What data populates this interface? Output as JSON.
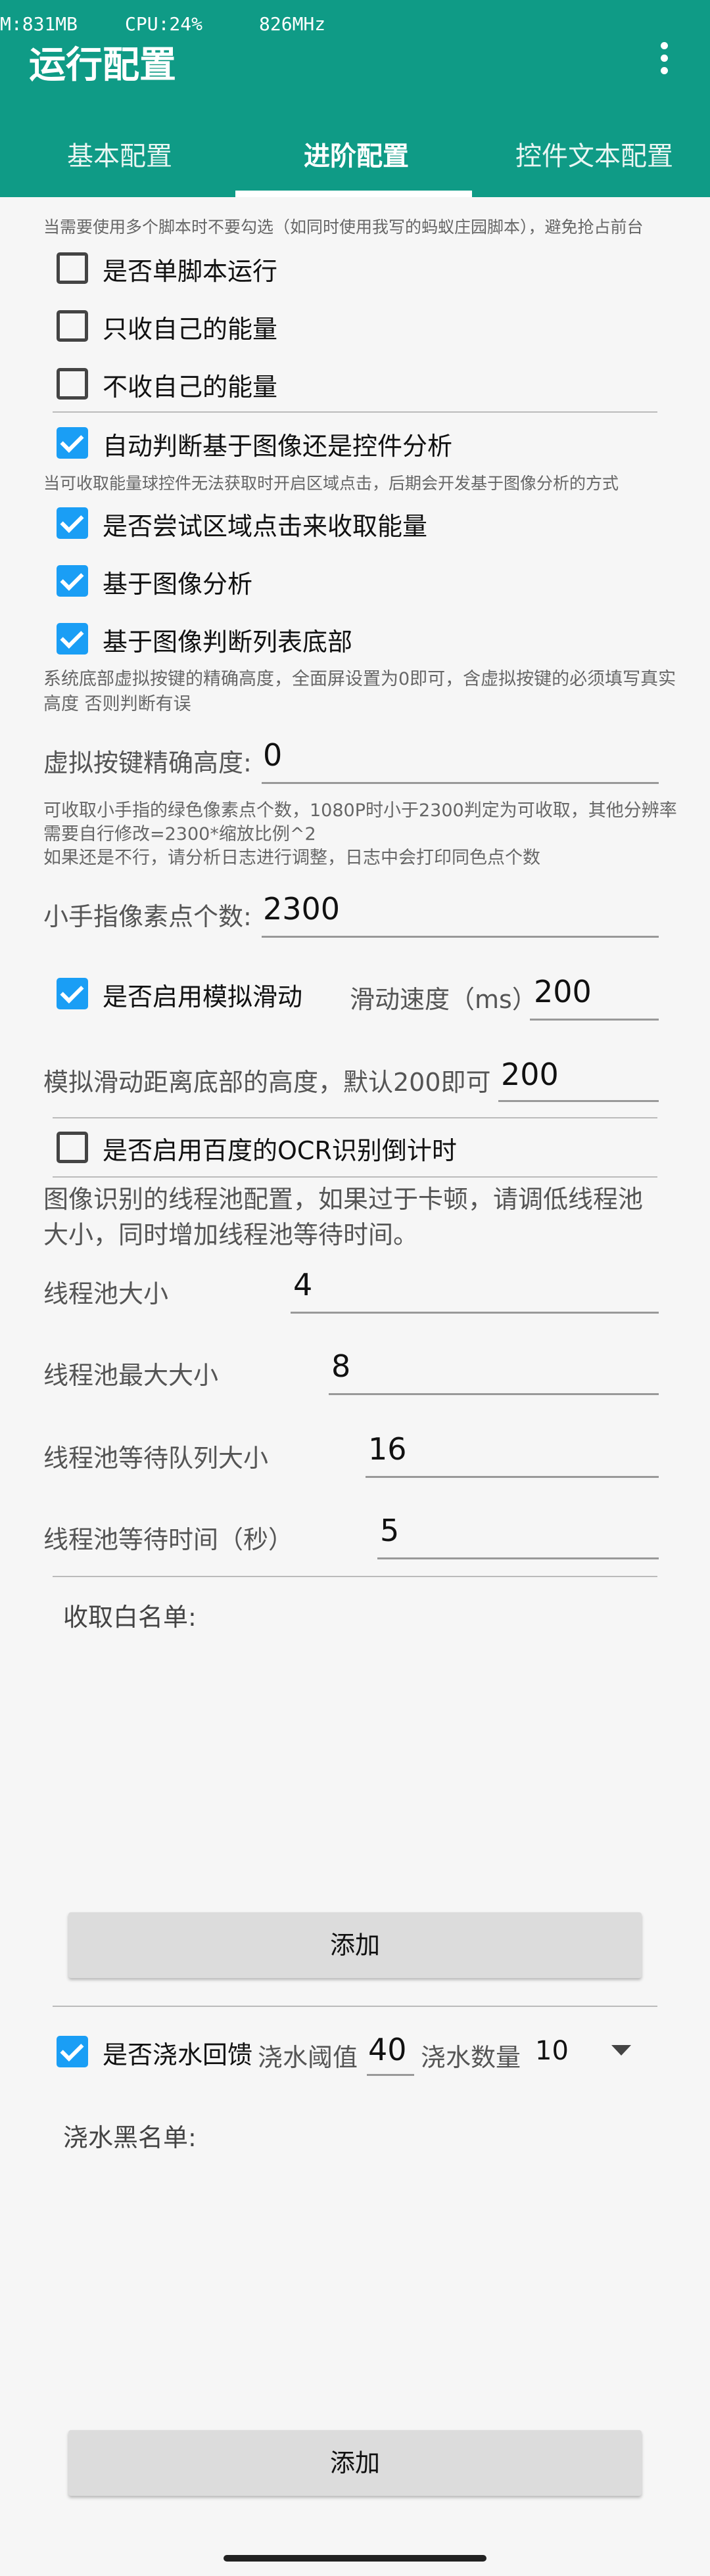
{
  "status_bar": {
    "memory": "M:831MB",
    "cpu": "CPU:24%",
    "freq": "826MHz"
  },
  "app": {
    "title": "运行配置",
    "menu_icon": "more-vert-icon"
  },
  "tabs": [
    {
      "label": "基本配置",
      "active": false
    },
    {
      "label": "进阶配置",
      "active": true
    },
    {
      "label": "控件文本配置",
      "active": false
    }
  ],
  "notes": {
    "multi_script": "当需要使用多个脚本时不要勾选（如同时使用我写的蚂蚁庄园脚本），避免抢占前台",
    "region_click": "当可收取能量球控件无法获取时开启区域点击，后期会开发基于图像分析的方式",
    "virtual_key_line1": "系统底部虚拟按键的精确高度，全面屏设置为0即可，含虚拟按键的必须填写真实",
    "virtual_key_line2": "高度 否则判断有误",
    "finger_line1": "可收取小手指的绿色像素点个数，1080P时小于2300判定为可收取，其他分辨率",
    "finger_line2": "需要自行修改=2300*缩放比例^2",
    "finger_line3": "如果还是不行，请分析日志进行调整，日志中会打印同色点个数",
    "thread_pool_line1": "图像识别的线程池配置，如果过于卡顿，请调低线程池",
    "thread_pool_line2": "大小，同时增加线程池等待时间。"
  },
  "checkboxes": {
    "single_script": {
      "label": "是否单脚本运行",
      "checked": false
    },
    "collect_own": {
      "label": "只收自己的能量",
      "checked": false
    },
    "not_collect_own": {
      "label": "不收自己的能量",
      "checked": false
    },
    "auto_detect": {
      "label": "自动判断基于图像还是控件分析",
      "checked": true
    },
    "region_click": {
      "label": "是否尝试区域点击来收取能量",
      "checked": true
    },
    "image_analysis": {
      "label": "基于图像分析",
      "checked": true
    },
    "image_list_bottom": {
      "label": "基于图像判断列表底部",
      "checked": true
    },
    "simulate_swipe": {
      "label": "是否启用模拟滑动",
      "checked": true
    },
    "baidu_ocr": {
      "label": "是否启用百度的OCR识别倒计时",
      "checked": false
    },
    "watering_feedback": {
      "label": "是否浇水回馈",
      "checked": true
    }
  },
  "fields": {
    "virtual_key_height": {
      "label": "虚拟按键精确高度:",
      "value": "0"
    },
    "finger_pixels": {
      "label": "小手指像素点个数:",
      "value": "2300"
    },
    "swipe_speed": {
      "label": "滑动速度（ms）",
      "value": "200"
    },
    "swipe_bottom_height": {
      "label": "模拟滑动距离底部的高度，默认200即可",
      "value": "200"
    },
    "thread_pool_size": {
      "label": "线程池大小",
      "value": "4"
    },
    "thread_pool_max": {
      "label": "线程池最大大小",
      "value": "8"
    },
    "thread_queue_size": {
      "label": "线程池等待队列大小",
      "value": "16"
    },
    "thread_wait_time": {
      "label": "线程池等待时间（秒）",
      "value": "5"
    },
    "watering_threshold": {
      "label": "浇水阈值",
      "value": "40"
    },
    "watering_count": {
      "label": "浇水数量",
      "value": "10"
    }
  },
  "whitelist": {
    "label": "收取白名单:",
    "add_button": "添加"
  },
  "blacklist": {
    "label": "浇水黑名单:",
    "add_button": "添加"
  }
}
